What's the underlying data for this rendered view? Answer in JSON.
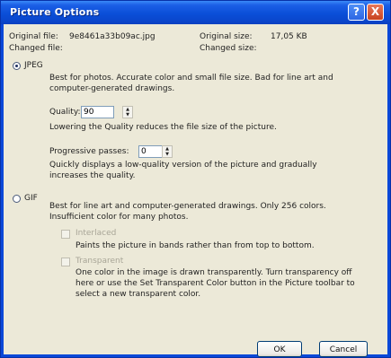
{
  "window": {
    "title": "Picture Options",
    "help_glyph": "?",
    "close_glyph": "X"
  },
  "file_info": {
    "original_file_label": "Original file:",
    "original_file_value": "9e8461a33b09ac.jpg",
    "changed_file_label": "Changed file:",
    "original_size_label": "Original size:",
    "original_size_value": "17,05 KB",
    "changed_size_label": "Changed size:"
  },
  "jpeg": {
    "label": "JPEG",
    "selected": true,
    "description_line1": "Best for photos.  Accurate color and small file size.  Bad for line art and",
    "description_line2": "computer-generated drawings.",
    "quality_label": "Quality:",
    "quality_value": "90",
    "quality_hint": "Lowering the Quality reduces the file size of the picture.",
    "progressive_label": "Progressive passes:",
    "progressive_value": "0",
    "progressive_hint_line1": "Quickly displays a low-quality version of the picture and gradually",
    "progressive_hint_line2": "increases the quality."
  },
  "gif": {
    "label": "GIF",
    "selected": false,
    "description_line1": "Best for line art and computer-generated drawings.  Only 256 colors.",
    "description_line2": "Insufficient color for many photos.",
    "interlaced_label": "Interlaced",
    "interlaced_hint": "Paints the picture in bands rather than from top to bottom.",
    "transparent_label": "Transparent",
    "transparent_hint_line1": "One color in the image is drawn transparently.  Turn transparency off",
    "transparent_hint_line2": "here or use the Set Transparent Color button in the Picture toolbar to",
    "transparent_hint_line3": "select a new transparent color."
  },
  "buttons": {
    "ok": "OK",
    "cancel": "Cancel"
  }
}
